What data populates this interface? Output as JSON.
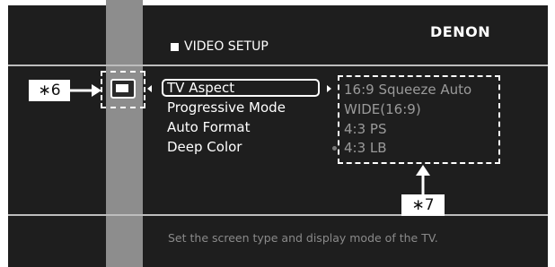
{
  "brand": "DENON",
  "header": {
    "title": "VIDEO SETUP"
  },
  "menu": {
    "items": [
      {
        "label": "TV Aspect"
      },
      {
        "label": "Progressive Mode"
      },
      {
        "label": "Auto Format"
      },
      {
        "label": "Deep Color"
      }
    ]
  },
  "options": {
    "items": [
      {
        "label": "16:9 Squeeze Auto"
      },
      {
        "label": "WIDE(16:9)"
      },
      {
        "label": "4:3 PS"
      },
      {
        "label": "4:3 LB"
      }
    ]
  },
  "help_text": "Set the screen type and display mode of the TV.",
  "callouts": {
    "icon": "∗6",
    "options": "∗7"
  },
  "icons": {
    "category": "video-setup-icon",
    "select_left": "arrow-left-icon",
    "select_right": "arrow-right-icon"
  },
  "colors": {
    "screen_bg": "#1e1e1e",
    "sidebar": "#8d8d8d",
    "text": "#ffffff",
    "option_text": "#9a9a9a"
  }
}
